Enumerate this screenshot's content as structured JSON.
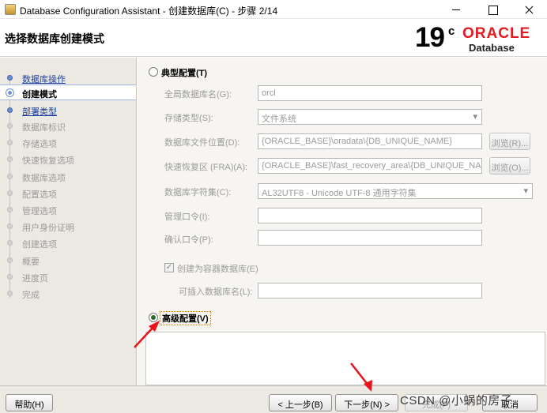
{
  "window": {
    "title": "Database Configuration Assistant - 创建数据库(C) - 步骤 2/14"
  },
  "header": {
    "page_title": "选择数据库创建模式",
    "logo": {
      "version": "19",
      "suffix": "c",
      "brand": "ORACLE",
      "product": "Database"
    }
  },
  "sidebar": {
    "steps": [
      {
        "label": "数据库操作",
        "state": "done"
      },
      {
        "label": "创建模式",
        "state": "current"
      },
      {
        "label": "部署类型",
        "state": "done"
      },
      {
        "label": "数据库标识",
        "state": "pending"
      },
      {
        "label": "存储选项",
        "state": "pending"
      },
      {
        "label": "快速恢复选项",
        "state": "pending"
      },
      {
        "label": "数据库选项",
        "state": "pending"
      },
      {
        "label": "配置选项",
        "state": "pending"
      },
      {
        "label": "管理选项",
        "state": "pending"
      },
      {
        "label": "用户身份证明",
        "state": "pending"
      },
      {
        "label": "创建选项",
        "state": "pending"
      },
      {
        "label": "概要",
        "state": "pending"
      },
      {
        "label": "进度页",
        "state": "pending"
      },
      {
        "label": "完成",
        "state": "pending"
      }
    ]
  },
  "main": {
    "typical": {
      "label": "典型配置(T)",
      "selected": false,
      "global_db_name_label": "全局数据库名(G):",
      "global_db_name_value": "orcl",
      "storage_type_label": "存储类型(S):",
      "storage_type_value": "文件系统",
      "db_file_location_label": "数据库文件位置(D):",
      "db_file_location_value": "{ORACLE_BASE}\\oradata\\{DB_UNIQUE_NAME}",
      "browse1_label": "浏览(R)...",
      "fra_label": "快速恢复区 (FRA)(A):",
      "fra_value": "{ORACLE_BASE}\\fast_recovery_area\\{DB_UNIQUE_NAME}",
      "browse2_label": "浏览(O)...",
      "charset_label": "数据库字符集(C):",
      "charset_value": "AL32UTF8 - Unicode UTF-8 通用字符集",
      "admin_password_label": "管理口令(I):",
      "confirm_password_label": "确认口令(P):",
      "container_db_label": "创建为容器数据库(E)",
      "container_db_checked": true,
      "pdb_name_label": "可插入数据库名(L):"
    },
    "advanced": {
      "label": "高级配置(V)",
      "selected": true
    }
  },
  "footer": {
    "help_label": "帮助(H)",
    "back_label": "< 上一步(B)",
    "next_label": "下一步(N) >",
    "finish_label": "完成(F)",
    "cancel_label": "取消",
    "watermark": "CSDN @小蜗的房子"
  },
  "colors": {
    "oracle_red": "#e31b23",
    "annotation_red": "#e8121a",
    "link_blue": "#1a3f9e"
  }
}
